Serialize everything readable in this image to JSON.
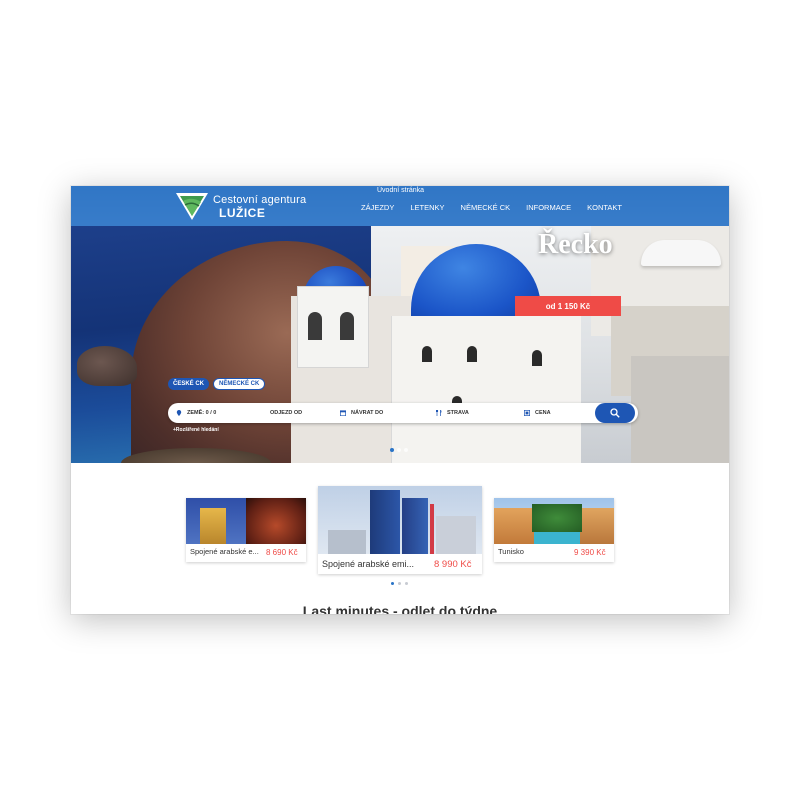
{
  "header": {
    "brand_line1": "Cestovní agentura",
    "brand_line2": "LUŽICE",
    "top_link": "Úvodní stránka",
    "nav": [
      "ZÁJEZDY",
      "LETENKY",
      "NĚMECKÉ CK",
      "INFORMACE",
      "KONTAKT"
    ]
  },
  "hero": {
    "title": "Řecko",
    "price": "od 1 150 Kč",
    "colors": {
      "accent": "#ef4b47",
      "primary": "#1e56b4",
      "topbar": "#2a74c7"
    }
  },
  "search": {
    "tabs": [
      "ČESKÉ CK",
      "NĚMECKÉ CK"
    ],
    "active_tab": "ČESKÉ CK",
    "fields": {
      "country": "ZEMĚ: 0 / 0",
      "departure": "ODJEZD OD",
      "return": "NÁVRAT DO",
      "board": "STRAVA",
      "price": "CENA"
    },
    "advanced": "+Rozšířené hledání",
    "icons": [
      "map-pin-icon",
      "calendar-icon",
      "calendar-icon",
      "fork-knife-icon",
      "price-icon",
      "search-icon"
    ]
  },
  "offers": [
    {
      "caption": "Spojené arabské e...",
      "price": "8 690 Kč"
    },
    {
      "caption": "Spojené arabské emi...",
      "price": "8 990 Kč"
    },
    {
      "caption": "Tunisko",
      "price": "9 390 Kč"
    }
  ],
  "section": {
    "title": "Last minutes - odlet do týdne"
  }
}
